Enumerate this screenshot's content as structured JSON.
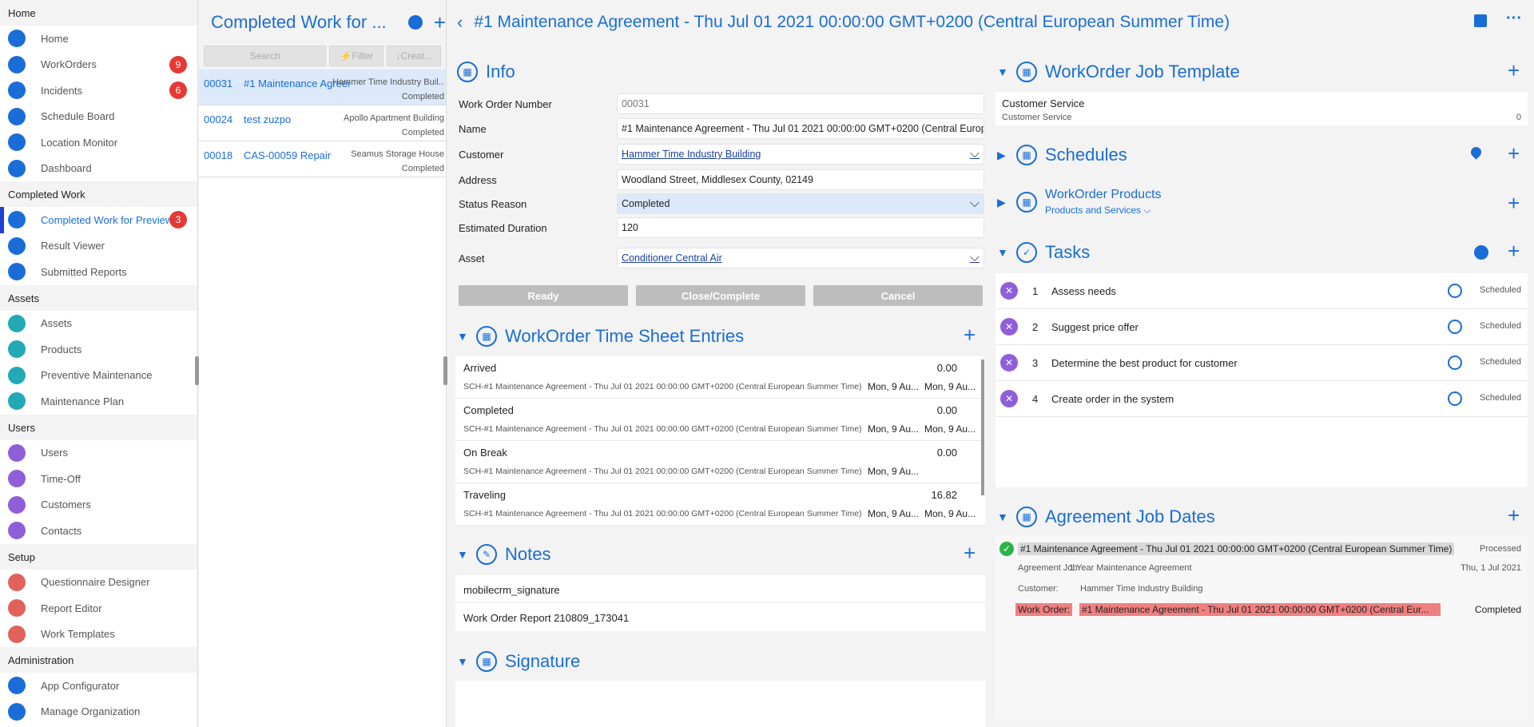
{
  "sidebar": {
    "sections": [
      {
        "title": "Home",
        "items": [
          {
            "label": "Home",
            "icon": "home-icon",
            "color": "#1a6dd6"
          },
          {
            "label": "WorkOrders",
            "icon": "workorders-icon",
            "color": "#1a6dd6",
            "badge": "9"
          },
          {
            "label": "Incidents",
            "icon": "warning-icon",
            "color": "#1a6dd6",
            "badge": "6"
          },
          {
            "label": "Schedule Board",
            "icon": "schedule-board-icon",
            "color": "#1a6dd6"
          },
          {
            "label": "Location Monitor",
            "icon": "location-icon",
            "color": "#1a6dd6"
          },
          {
            "label": "Dashboard",
            "icon": "dashboard-icon",
            "color": "#1a6dd6"
          }
        ]
      },
      {
        "title": "Completed Work",
        "items": [
          {
            "label": "Completed Work for Preview",
            "icon": "checklist-icon",
            "color": "#1a6dd6",
            "badge": "3",
            "active": true
          },
          {
            "label": "Result Viewer",
            "icon": "grid-icon",
            "color": "#1a6dd6"
          },
          {
            "label": "Submitted Reports",
            "icon": "globe-icon",
            "color": "#1a6dd6"
          }
        ]
      },
      {
        "title": "Assets",
        "items": [
          {
            "label": "Assets",
            "icon": "assets-icon",
            "color": "#22a9b5"
          },
          {
            "label": "Products",
            "icon": "products-icon",
            "color": "#22a9b5"
          },
          {
            "label": "Preventive Maintenance",
            "icon": "preventive-icon",
            "color": "#22a9b5"
          },
          {
            "label": "Maintenance Plan",
            "icon": "plan-icon",
            "color": "#22a9b5"
          }
        ]
      },
      {
        "title": "Users",
        "items": [
          {
            "label": "Users",
            "icon": "user-icon",
            "color": "#8e5fd9"
          },
          {
            "label": "Time-Off",
            "icon": "time-off-icon",
            "color": "#8e5fd9"
          },
          {
            "label": "Customers",
            "icon": "customers-icon",
            "color": "#8e5fd9"
          },
          {
            "label": "Contacts",
            "icon": "contacts-icon",
            "color": "#8e5fd9"
          }
        ]
      },
      {
        "title": "Setup",
        "items": [
          {
            "label": "Questionnaire Designer",
            "icon": "questionnaire-icon",
            "color": "#e0625a"
          },
          {
            "label": "Report Editor",
            "icon": "report-icon",
            "color": "#e0625a"
          },
          {
            "label": "Work Templates",
            "icon": "templates-icon",
            "color": "#e0625a"
          }
        ]
      },
      {
        "title": "Administration",
        "items": [
          {
            "label": "App Configurator",
            "icon": "configurator-icon",
            "color": "#1a6dd6"
          },
          {
            "label": "Manage Organization",
            "icon": "organization-icon",
            "color": "#1a6dd6"
          }
        ]
      }
    ]
  },
  "list": {
    "title": "Completed Work for ...",
    "search_placeholder": "Search",
    "filter_label": "Filter",
    "create_label": "Creat...",
    "rows": [
      {
        "num": "00031",
        "name": "#1 Maintenance Agreem...",
        "location": "Hammer Time Industry Buil...",
        "status": "Completed",
        "selected": true
      },
      {
        "num": "00024",
        "name": "test zuzpo",
        "location": "Apollo Apartment Building",
        "status": "Completed"
      },
      {
        "num": "00018",
        "name": "CAS-00059 Repair",
        "location": "Seamus Storage House",
        "status": "Completed"
      }
    ]
  },
  "header": {
    "title": "#1 Maintenance Agreement - Thu Jul 01 2021 00:00:00 GMT+0200 (Central European Summer Time)"
  },
  "info": {
    "title": "Info",
    "fields": [
      {
        "label": "Work Order Number",
        "value": "00031",
        "style": "muted"
      },
      {
        "label": "Name",
        "value": "#1 Maintenance Agreement - Thu Jul 01 2021 00:00:00 GMT+0200 (Central Europ",
        "style": ""
      },
      {
        "label": "Customer",
        "value": "Hammer Time Industry Building",
        "style": "link",
        "dropdown": true
      },
      {
        "label": "Address",
        "value": "Woodland Street, Middlesex County, 02149",
        "style": ""
      },
      {
        "label": "Status Reason",
        "value": "Completed",
        "style": "hl",
        "dropdown": true
      },
      {
        "label": "Estimated Duration",
        "value": "120",
        "style": ""
      },
      {
        "label": "Asset",
        "value": "Conditioner Central Air",
        "style": "link",
        "dropdown": true
      }
    ],
    "buttons": {
      "ready": "Ready",
      "close": "Close/Complete",
      "cancel": "Cancel"
    }
  },
  "timesheet": {
    "title": "WorkOrder Time Sheet Entries",
    "rows": [
      {
        "name": "Arrived",
        "value": "0.00",
        "sub": "SCH-#1 Maintenance Agreement - Thu Jul 01 2021 00:00:00 GMT+0200 (Central European Summer Time)",
        "d1": "Mon, 9 Au...",
        "d2": "Mon, 9 Au..."
      },
      {
        "name": "Completed",
        "value": "0.00",
        "sub": "SCH-#1 Maintenance Agreement - Thu Jul 01 2021 00:00:00 GMT+0200 (Central European Summer Time)",
        "d1": "Mon, 9 Au...",
        "d2": "Mon, 9 Au..."
      },
      {
        "name": "On Break",
        "value": "0.00",
        "sub": "SCH-#1 Maintenance Agreement - Thu Jul 01 2021 00:00:00 GMT+0200 (Central European Summer Time)",
        "d1": "Mon, 9 Au...",
        "d2": ""
      },
      {
        "name": "Traveling",
        "value": "16.82",
        "sub": "SCH-#1 Maintenance Agreement - Thu Jul 01 2021 00:00:00 GMT+0200 (Central European Summer Time)",
        "d1": "Mon, 9 Au...",
        "d2": "Mon, 9 Au..."
      }
    ]
  },
  "notes": {
    "title": "Notes",
    "items": [
      "mobilecrm_signature",
      "Work Order Report 210809_173041"
    ]
  },
  "signature": {
    "title": "Signature"
  },
  "job_template": {
    "title": "WorkOrder Job Template",
    "name": "Customer Service",
    "sub": "Customer Service",
    "count": "0"
  },
  "schedules": {
    "title": "Schedules"
  },
  "products": {
    "title": "WorkOrder Products",
    "sub": "Products and Services"
  },
  "tasks": {
    "title": "Tasks",
    "rows": [
      {
        "num": "1",
        "name": "Assess needs",
        "status": "Scheduled"
      },
      {
        "num": "2",
        "name": "Suggest price offer",
        "status": "Scheduled"
      },
      {
        "num": "3",
        "name": "Determine the best product for customer",
        "status": "Scheduled"
      },
      {
        "num": "4",
        "name": "Create order in the system",
        "status": "Scheduled"
      }
    ]
  },
  "agreement": {
    "title": "Agreement Job Dates",
    "name": "#1 Maintenance Agreement - Thu Jul 01 2021 00:00:00 GMT+0200 (Central European Summer Time)",
    "state": "Processed",
    "job_label": "Agreement Job:",
    "job_value": "1 Year Maintenance Agreement",
    "date": "Thu, 1 Jul 2021",
    "customer_label": "Customer:",
    "customer_value": "Hammer Time Industry Building",
    "wo_label": "Work Order:",
    "wo_value": "#1 Maintenance Agreement - Thu Jul 01 2021 00:00:00 GMT+0200 (Central Eur...",
    "wo_status": "Completed"
  }
}
